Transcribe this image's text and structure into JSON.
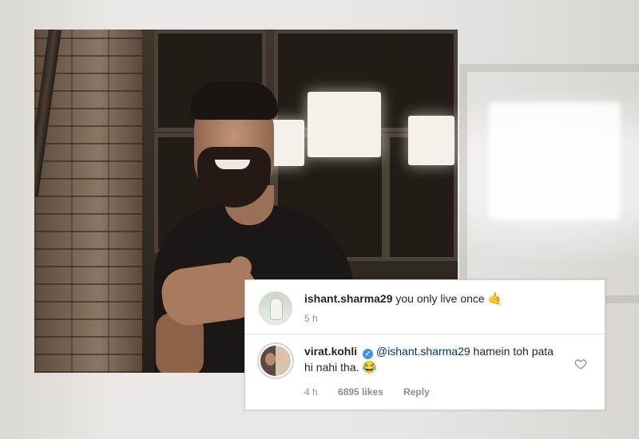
{
  "comments": [
    {
      "username": "ishant.sharma29",
      "text": "you only live once",
      "emoji": "🤙",
      "time": "5 h"
    },
    {
      "username": "virat.kohli",
      "verified": true,
      "mention": "@ishant.sharma29",
      "text": "hamein toh pata hi nahi tha.",
      "emoji": "😂",
      "time": "4 h",
      "likes": "6895 likes",
      "reply_label": "Reply"
    }
  ],
  "colors": {
    "username": "#262626",
    "meta": "#8e8e8e",
    "mention": "#003569",
    "verified_badge": "#3897f0"
  },
  "icons": {
    "like": "heart-outline-icon",
    "verified": "verified-badge-icon"
  }
}
